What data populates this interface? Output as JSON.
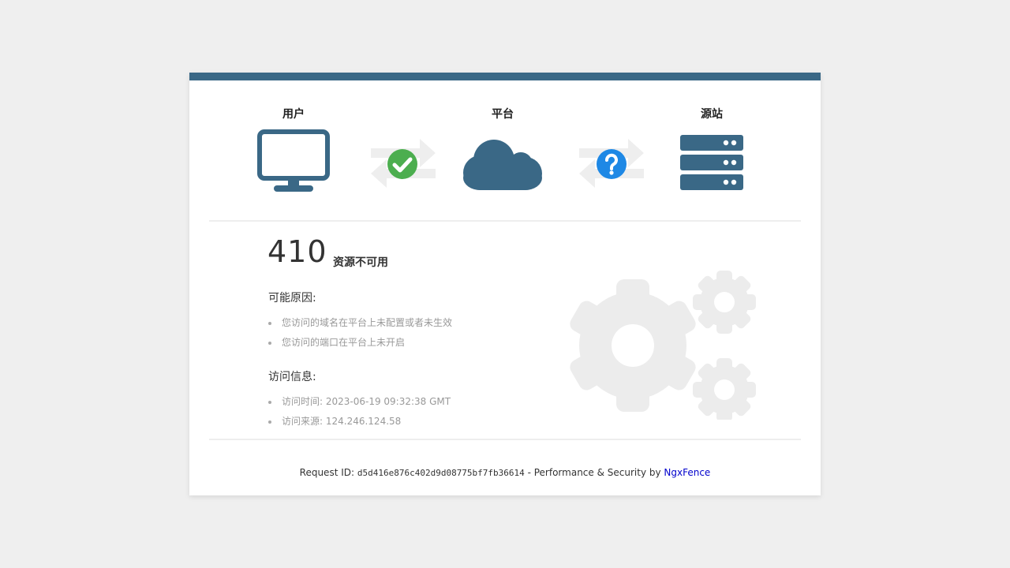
{
  "status": {
    "user": {
      "label": "用户",
      "icon": "monitor-icon"
    },
    "platform": {
      "label": "平台",
      "icon": "cloud-icon"
    },
    "origin": {
      "label": "源站",
      "icon": "server-icon"
    },
    "link_user_platform": {
      "icon": "check-circle-icon",
      "state": "ok",
      "color": "#4cae4f"
    },
    "link_platform_origin": {
      "icon": "question-circle-icon",
      "state": "unknown",
      "color": "#1e88e5"
    }
  },
  "error": {
    "code": "410",
    "message": "资源不可用"
  },
  "reasons": {
    "title": "可能原因:",
    "items": [
      "您访问的域名在平台上未配置或者未生效",
      "您访问的端口在平台上未开启"
    ]
  },
  "access_info": {
    "title": "访问信息:",
    "items": [
      "访问时间: 2023-06-19 09:32:38 GMT",
      "访问来源: 124.246.124.58"
    ]
  },
  "footer": {
    "request_prefix": "Request ID: ",
    "request_id": "d5d416e876c402d9d08775bf7fb36614",
    "middle": " - Performance & Security by ",
    "brand": "NgxFence"
  },
  "colors": {
    "accent": "#3a6886",
    "success": "#4cae4f",
    "info": "#1e88e5",
    "muted": "#e8e8e8"
  }
}
